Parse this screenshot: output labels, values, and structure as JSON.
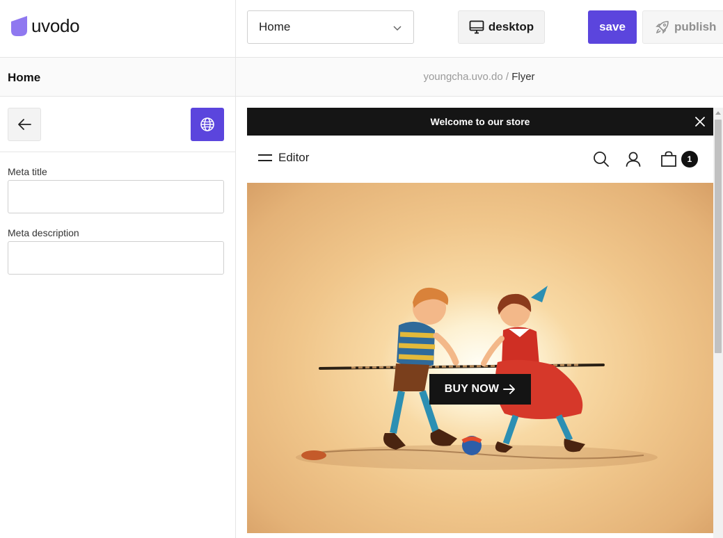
{
  "app": {
    "logo_text": "uvodo",
    "brand_color": "#5b45dd"
  },
  "toolbar": {
    "page_select": {
      "value": "Home"
    },
    "desktop_label": "desktop",
    "save_label": "save",
    "publish_label": "publish"
  },
  "sidebar": {
    "title": "Home",
    "meta_title_label": "Meta title",
    "meta_title_value": "",
    "meta_description_label": "Meta description",
    "meta_description_value": ""
  },
  "breadcrumb": {
    "domain": "youngcha.uvo.do",
    "separator": " / ",
    "current": "Flyer"
  },
  "preview": {
    "announcement": "Welcome to our store",
    "menu_label": "Editor",
    "cart_count": "1",
    "hero_button": "BUY NOW"
  },
  "icons": {
    "back": "arrow-left-icon",
    "globe": "globe-icon",
    "desktop": "monitor-icon",
    "publish": "rocket-icon",
    "search": "search-icon",
    "account": "user-icon",
    "cart": "shopping-bag-icon",
    "close": "close-icon",
    "menu": "hamburger-icon"
  }
}
